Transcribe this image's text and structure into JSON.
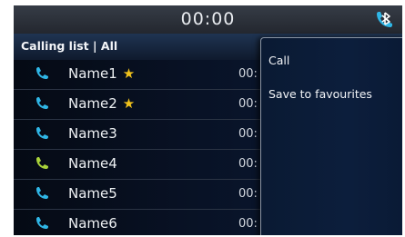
{
  "status_bar": {
    "clock": "00:00",
    "icon": "bluetooth-phone-icon"
  },
  "header": {
    "title": "Calling list | All"
  },
  "call_list": [
    {
      "name": "Name1",
      "favourite": true,
      "time": "00:",
      "call_type": "phone-icon",
      "color": "#2fb6e6"
    },
    {
      "name": "Name2",
      "favourite": true,
      "time": "00:",
      "call_type": "phone-icon",
      "color": "#2fb6e6"
    },
    {
      "name": "Name3",
      "favourite": false,
      "time": "00:",
      "call_type": "phone-icon",
      "color": "#2fb6e6"
    },
    {
      "name": "Name4",
      "favourite": false,
      "time": "00:",
      "call_type": "phone-icon",
      "color": "#a9d33a"
    },
    {
      "name": "Name5",
      "favourite": false,
      "time": "00:",
      "call_type": "phone-icon",
      "color": "#2fb6e6"
    },
    {
      "name": "Name6",
      "favourite": false,
      "time": "00:",
      "call_type": "phone-icon",
      "color": "#2fb6e6"
    }
  ],
  "context_menu": {
    "items": [
      {
        "label": "Call"
      },
      {
        "label": "Save to favourites"
      }
    ]
  },
  "colors": {
    "accent": "#2fb6e6",
    "star": "#f1c21b"
  }
}
